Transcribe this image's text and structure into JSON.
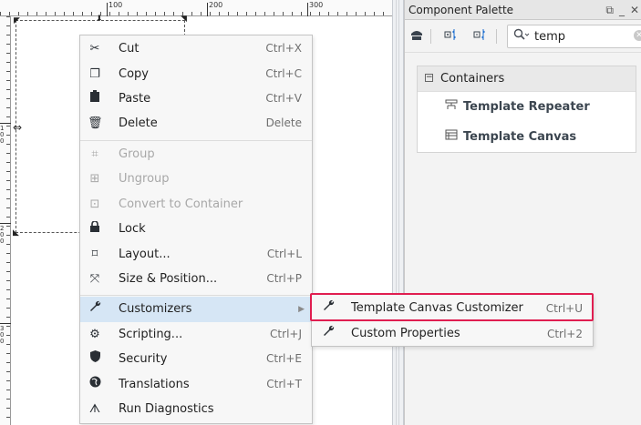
{
  "ruler": {
    "labels": [
      "100",
      "200",
      "300"
    ],
    "left_labels": [
      "100",
      "200",
      "300"
    ]
  },
  "palette": {
    "title": "Component Palette",
    "search": {
      "value": "temp",
      "placeholder": ""
    },
    "group": "Containers",
    "components": [
      {
        "label": "Template Repeater",
        "icon": "template-repeater-icon"
      },
      {
        "label": "Template Canvas",
        "icon": "template-canvas-icon"
      }
    ]
  },
  "context_menu": {
    "items": [
      {
        "label": "Cut",
        "shortcut": "Ctrl+X",
        "icon": "scissors-icon",
        "enabled": true
      },
      {
        "label": "Copy",
        "shortcut": "Ctrl+C",
        "icon": "copy-icon",
        "enabled": true
      },
      {
        "label": "Paste",
        "shortcut": "Ctrl+V",
        "icon": "paste-icon",
        "enabled": true
      },
      {
        "label": "Delete",
        "shortcut": "Delete",
        "icon": "trash-icon",
        "enabled": true
      },
      {
        "label": "Group",
        "shortcut": "",
        "icon": "group-icon",
        "enabled": false
      },
      {
        "label": "Ungroup",
        "shortcut": "",
        "icon": "ungroup-icon",
        "enabled": false
      },
      {
        "label": "Convert to Container",
        "shortcut": "",
        "icon": "convert-container-icon",
        "enabled": false
      },
      {
        "label": "Lock",
        "shortcut": "",
        "icon": "lock-icon",
        "enabled": true
      },
      {
        "label": "Layout...",
        "shortcut": "Ctrl+L",
        "icon": "layout-icon",
        "enabled": true
      },
      {
        "label": "Size & Position...",
        "shortcut": "Ctrl+P",
        "icon": "size-position-icon",
        "enabled": true
      },
      {
        "label": "Customizers",
        "shortcut": "",
        "icon": "wrench-icon",
        "enabled": true,
        "submenu": true
      },
      {
        "label": "Scripting...",
        "shortcut": "Ctrl+J",
        "icon": "scripting-icon",
        "enabled": true
      },
      {
        "label": "Security",
        "shortcut": "Ctrl+E",
        "icon": "shield-icon",
        "enabled": true
      },
      {
        "label": "Translations",
        "shortcut": "Ctrl+T",
        "icon": "globe-icon",
        "enabled": true
      },
      {
        "label": "Run Diagnostics",
        "shortcut": "",
        "icon": "diagnostics-icon",
        "enabled": true
      }
    ]
  },
  "sub_menu": {
    "items": [
      {
        "label": "Template Canvas Customizer",
        "shortcut": "Ctrl+U",
        "icon": "wrench-icon"
      },
      {
        "label": "Custom Properties",
        "shortcut": "Ctrl+2",
        "icon": "wrench-icon"
      }
    ]
  },
  "colors": {
    "highlight": "#e01e50",
    "hover": "#d6e6f5"
  }
}
